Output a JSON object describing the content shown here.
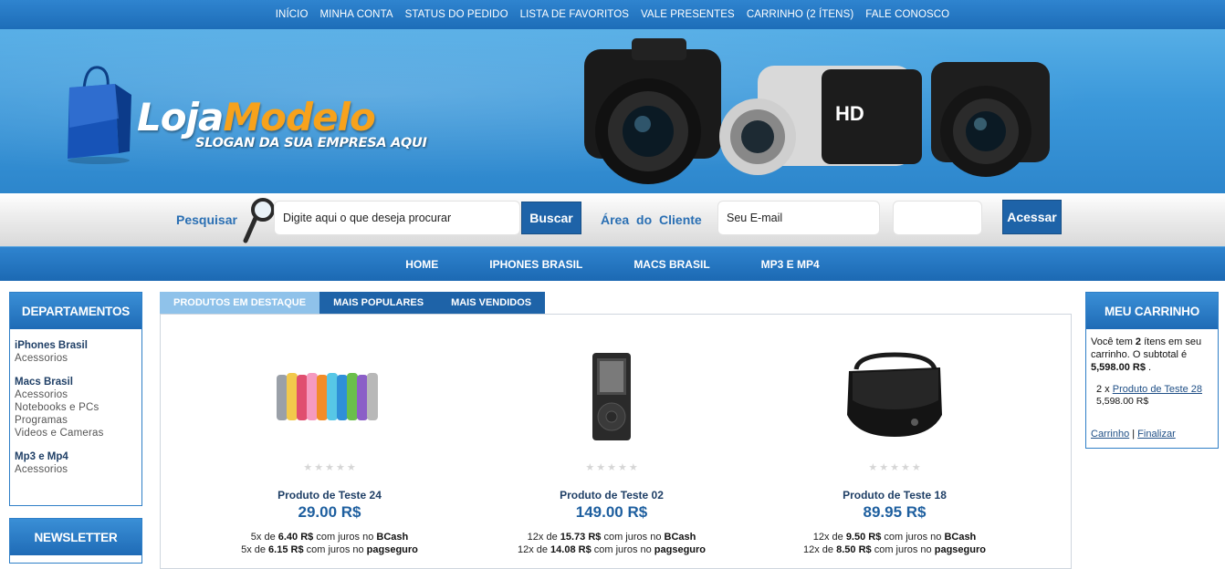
{
  "top_nav": {
    "items": [
      "INÍCIO",
      "MINHA CONTA",
      "STATUS DO PEDIDO",
      "LISTA DE FAVORITOS",
      "VALE PRESENTES",
      "CARRINHO (2 ÍTENS)",
      "FALE CONOSCO"
    ]
  },
  "brand": {
    "logo_part1": "Loja",
    "logo_part2": "Modelo",
    "slogan": "SLOGAN DA SUA EMPRESA AQUI",
    "banner_camera_label": "HD"
  },
  "search": {
    "label": "Pesquisar",
    "placeholder": "Digite aqui o que deseja procurar",
    "button": "Buscar"
  },
  "client_area": {
    "label": "Área do Cliente",
    "email_placeholder": "Seu E-mail",
    "password_value": "",
    "button": "Acessar"
  },
  "main_nav": {
    "items": [
      "HOME",
      "IPHONES BRASIL",
      "MACS BRASIL",
      "MP3 E MP4"
    ]
  },
  "departments": {
    "title": "DEPARTAMENTOS",
    "groups": [
      {
        "title": "iPhones Brasil",
        "items": [
          "Acessorios"
        ]
      },
      {
        "title": "Macs Brasil",
        "items": [
          "Acessorios",
          "Notebooks e PCs",
          "Programas",
          "Videos e Cameras"
        ]
      },
      {
        "title": "Mp3 e Mp4",
        "items": [
          "Acessorios"
        ]
      }
    ]
  },
  "newsletter": {
    "title": "NEWSLETTER"
  },
  "tabs": [
    "PRODUTOS EM DESTAQUE",
    "MAIS POPULARES",
    "MAIS VENDIDOS"
  ],
  "products": [
    {
      "name": "Produto de Teste 24",
      "price": "29.00 R$",
      "inst1_pre": "5x de ",
      "inst1_val": "6.40 R$",
      "inst1_mid": " com juros no ",
      "inst1_brand": "BCash",
      "inst2_pre": "5x de ",
      "inst2_val": "6.15 R$",
      "inst2_mid": " com juros no ",
      "inst2_brand": "pagseguro",
      "image": "colorful-socks"
    },
    {
      "name": "Produto de Teste 02",
      "price": "149.00 R$",
      "inst1_pre": "12x de ",
      "inst1_val": "15.73 R$",
      "inst1_mid": " com juros no ",
      "inst1_brand": "BCash",
      "inst2_pre": "12x de ",
      "inst2_val": "14.08 R$",
      "inst2_mid": " com juros no ",
      "inst2_brand": "pagseguro",
      "image": "ipod-nano"
    },
    {
      "name": "Produto de Teste 18",
      "price": "89.95 R$",
      "inst1_pre": "12x de ",
      "inst1_val": "9.50 R$",
      "inst1_mid": " com juros no ",
      "inst1_brand": "BCash",
      "inst2_pre": "12x de ",
      "inst2_val": "8.50 R$",
      "inst2_mid": " com juros no ",
      "inst2_brand": "pagseguro",
      "image": "black-bag"
    }
  ],
  "cart": {
    "title": "MEU CARRINHO",
    "text_pre": "Você tem ",
    "count": "2",
    "text_mid": " ítens em seu carrinho. O subtotal é ",
    "subtotal": "5,598.00 R$",
    "text_end": " .",
    "line_qty": "2 x ",
    "line_product": "Produto de Teste 28",
    "line_price": "5,598.00 R$",
    "link_cart": "Carrinho",
    "separator": " | ",
    "link_finish": "Finalizar"
  },
  "colors": {
    "primary": "#1e63a8",
    "accent": "#f7a21c",
    "banner": "#3b98da"
  }
}
